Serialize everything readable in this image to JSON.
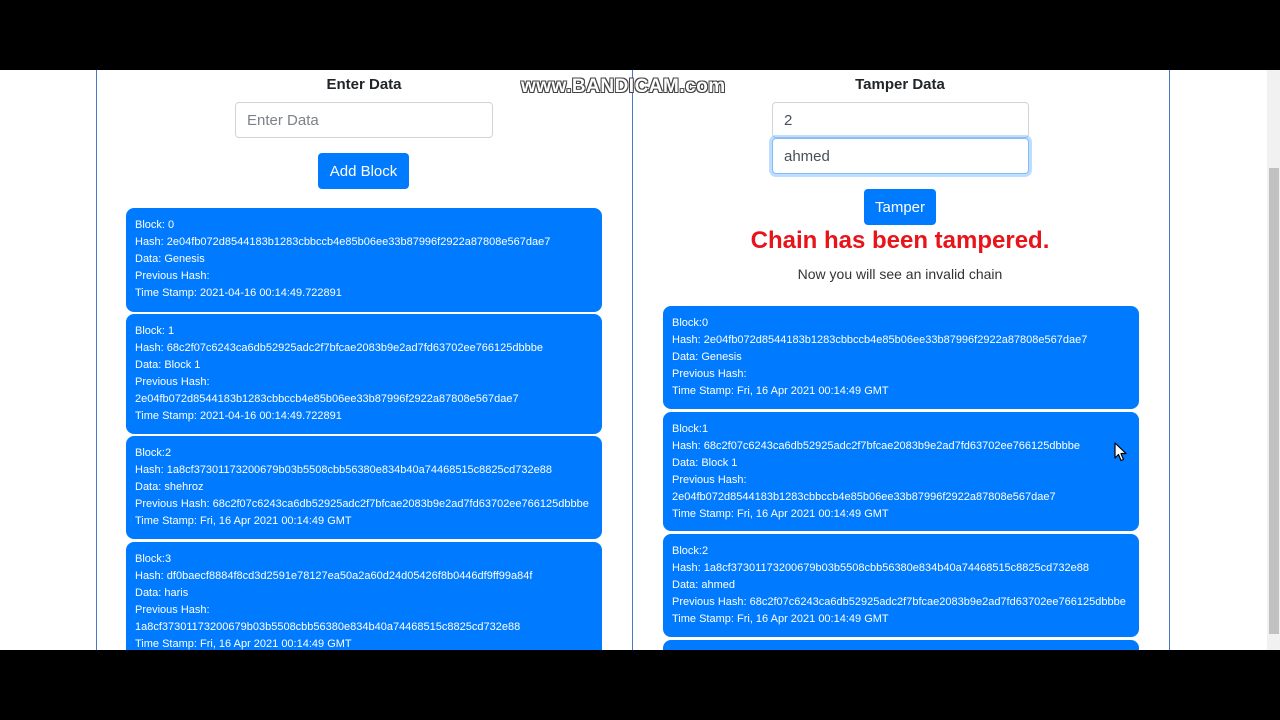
{
  "watermark": "www.BANDICAM.com",
  "left": {
    "heading": "Enter Data",
    "input_placeholder": "Enter Data",
    "add_button": "Add Block",
    "blocks": [
      {
        "lines": [
          "Block: 0",
          "Hash: 2e04fb072d8544183b1283cbbccb4e85b06ee33b87996f2922a87808e567dae7",
          "Data: Genesis",
          "Previous Hash:",
          "Time Stamp: 2021-04-16 00:14:49.722891"
        ]
      },
      {
        "lines": [
          "Block: 1",
          "Hash: 68c2f07c6243ca6db52925adc2f7bfcae2083b9e2ad7fd63702ee766125dbbbe",
          "Data: Block 1",
          "Previous Hash:",
          "2e04fb072d8544183b1283cbbccb4e85b06ee33b87996f2922a87808e567dae7",
          "Time Stamp: 2021-04-16 00:14:49.722891"
        ]
      },
      {
        "lines": [
          "Block:2",
          "Hash: 1a8cf37301173200679b03b5508cbb56380e834b40a74468515c8825cd732e88",
          "Data: shehroz",
          "Previous Hash: 68c2f07c6243ca6db52925adc2f7bfcae2083b9e2ad7fd63702ee766125dbbbe",
          "Time Stamp: Fri, 16 Apr 2021 00:14:49 GMT"
        ]
      },
      {
        "lines": [
          "Block:3",
          "Hash: df0baecf8884f8cd3d2591e78127ea50a2a60d24d05426f8b0446df9ff99a84f",
          "Data: haris",
          "Previous Hash:",
          "1a8cf37301173200679b03b5508cbb56380e834b40a74468515c8825cd732e88",
          "Time Stamp: Fri, 16 Apr 2021 00:14:49 GMT"
        ]
      }
    ]
  },
  "right": {
    "heading": "Tamper Data",
    "index_value": "2",
    "data_value": "ahmed",
    "tamper_button": "Tamper",
    "alert_title": "Chain has been tampered.",
    "alert_subtitle": "Now you will see an invalid chain",
    "blocks": [
      {
        "lines": [
          "Block:0",
          "Hash: 2e04fb072d8544183b1283cbbccb4e85b06ee33b87996f2922a87808e567dae7",
          "Data: Genesis",
          "Previous Hash:",
          "Time Stamp: Fri, 16 Apr 2021 00:14:49 GMT"
        ]
      },
      {
        "lines": [
          "Block:1",
          "Hash: 68c2f07c6243ca6db52925adc2f7bfcae2083b9e2ad7fd63702ee766125dbbbe",
          "Data: Block 1",
          "Previous Hash:",
          "2e04fb072d8544183b1283cbbccb4e85b06ee33b87996f2922a87808e567dae7",
          "Time Stamp: Fri, 16 Apr 2021 00:14:49 GMT"
        ]
      },
      {
        "lines": [
          "Block:2",
          "Hash: 1a8cf37301173200679b03b5508cbb56380e834b40a74468515c8825cd732e88",
          "Data: ahmed",
          "Previous Hash: 68c2f07c6243ca6db52925adc2f7bfcae2083b9e2ad7fd63702ee766125dbbbe",
          "Time Stamp: Fri, 16 Apr 2021 00:14:49 GMT"
        ]
      }
    ]
  },
  "colors": {
    "primary": "#007bff",
    "alert": "#e8141a",
    "frame_border": "#4a78c8"
  }
}
